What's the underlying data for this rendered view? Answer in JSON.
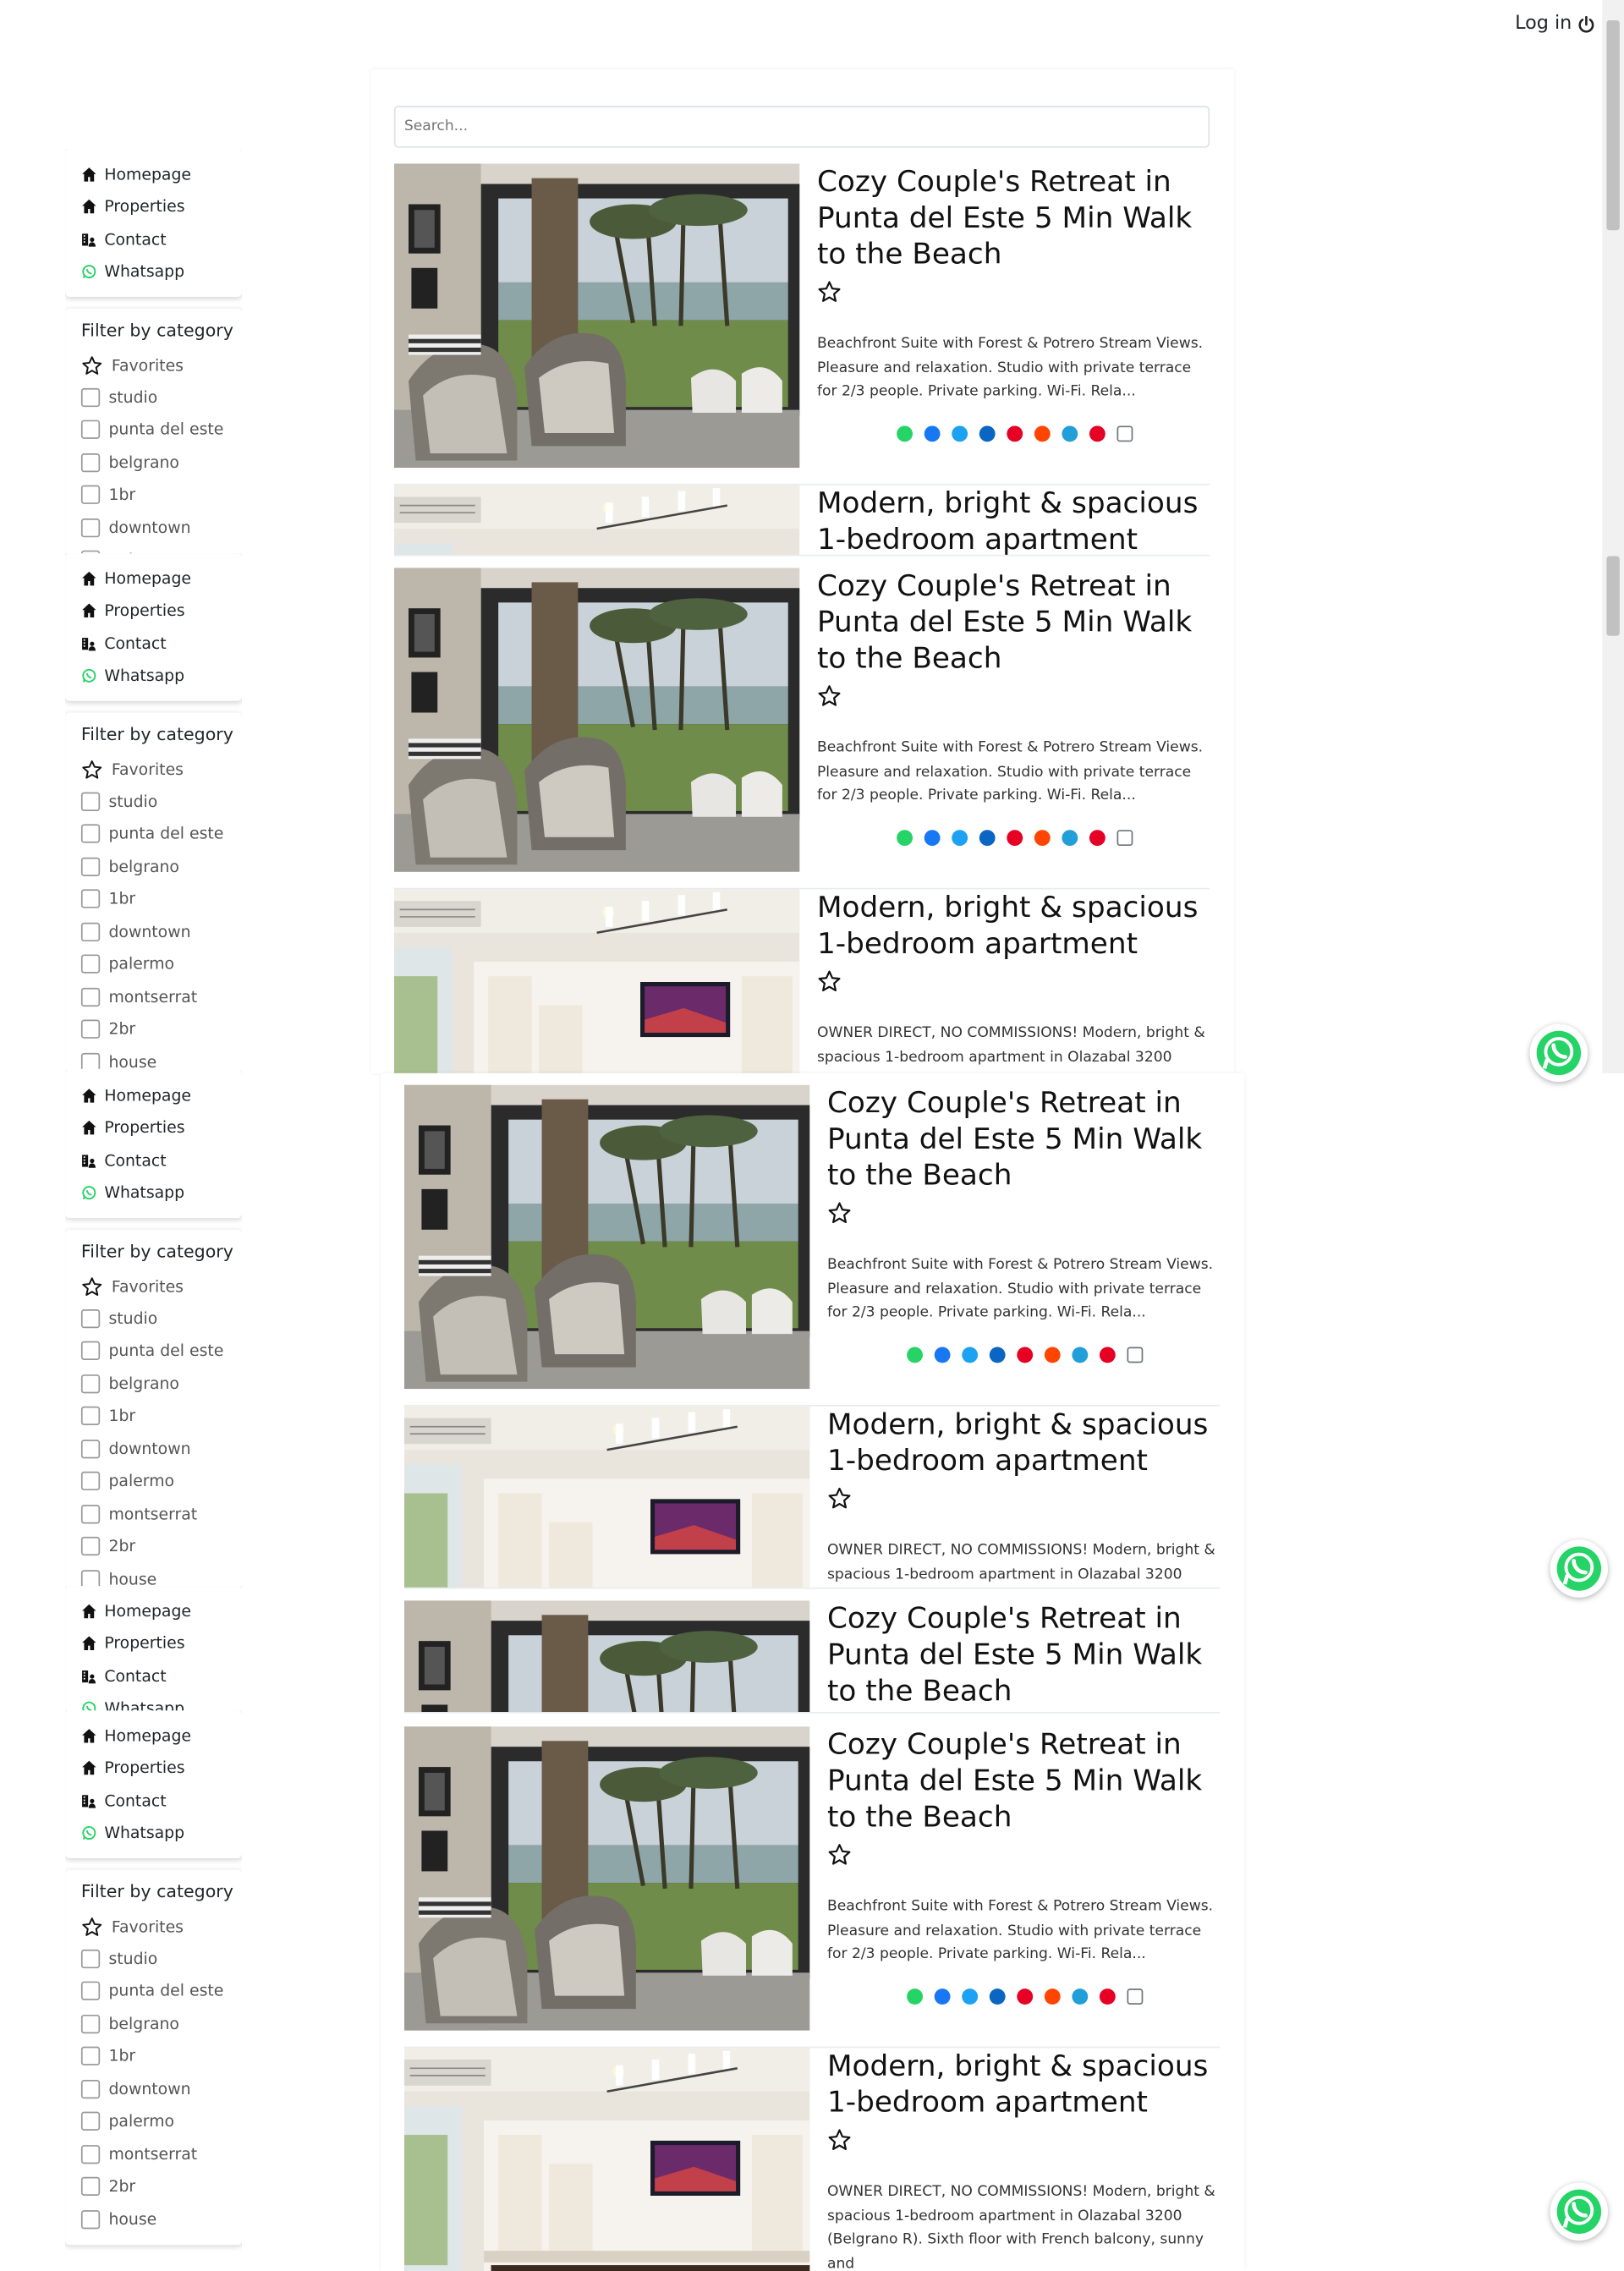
{
  "header": {
    "login_label": "Log in"
  },
  "nav": {
    "items": [
      {
        "label": "Homepage",
        "icon": "home-icon"
      },
      {
        "label": "Properties",
        "icon": "home-icon"
      },
      {
        "label": "Contact",
        "icon": "contact-icon"
      },
      {
        "label": "Whatsapp",
        "icon": "whatsapp-icon"
      }
    ]
  },
  "filter": {
    "title": "Filter by category",
    "favorites_label": "Favorites",
    "categories": [
      "studio",
      "punta del este",
      "belgrano",
      "1br",
      "downtown",
      "palermo",
      "montserrat",
      "2br",
      "house"
    ]
  },
  "search": {
    "placeholder": "Search..."
  },
  "listings": [
    {
      "title": "Cozy Couple's Retreat in Punta del Este 5 Min Walk to the Beach",
      "description": "Beachfront Suite with Forest & Potrero Stream Views. Pleasure and relaxation. Studio with private terrace for 2/3 people. Private parking. Wi-Fi. Rela..."
    },
    {
      "title": "Modern, bright & spacious 1-bedroom apartment",
      "description": "OWNER DIRECT, NO COMMISSIONS! Modern, bright & spacious 1-bedroom apartment in Olazabal 3200 (Belgrano R). Sixth floor with French balcony, sunny and"
    }
  ],
  "colors": {
    "whatsapp": "#25d366",
    "facebook": "#1877f2",
    "twitter": "#1da1f2",
    "linkedin": "#0a66c2",
    "pinterest": "#e60023",
    "reddit": "#ff4500",
    "telegram": "#229ed9",
    "copy": "#6c757d"
  }
}
